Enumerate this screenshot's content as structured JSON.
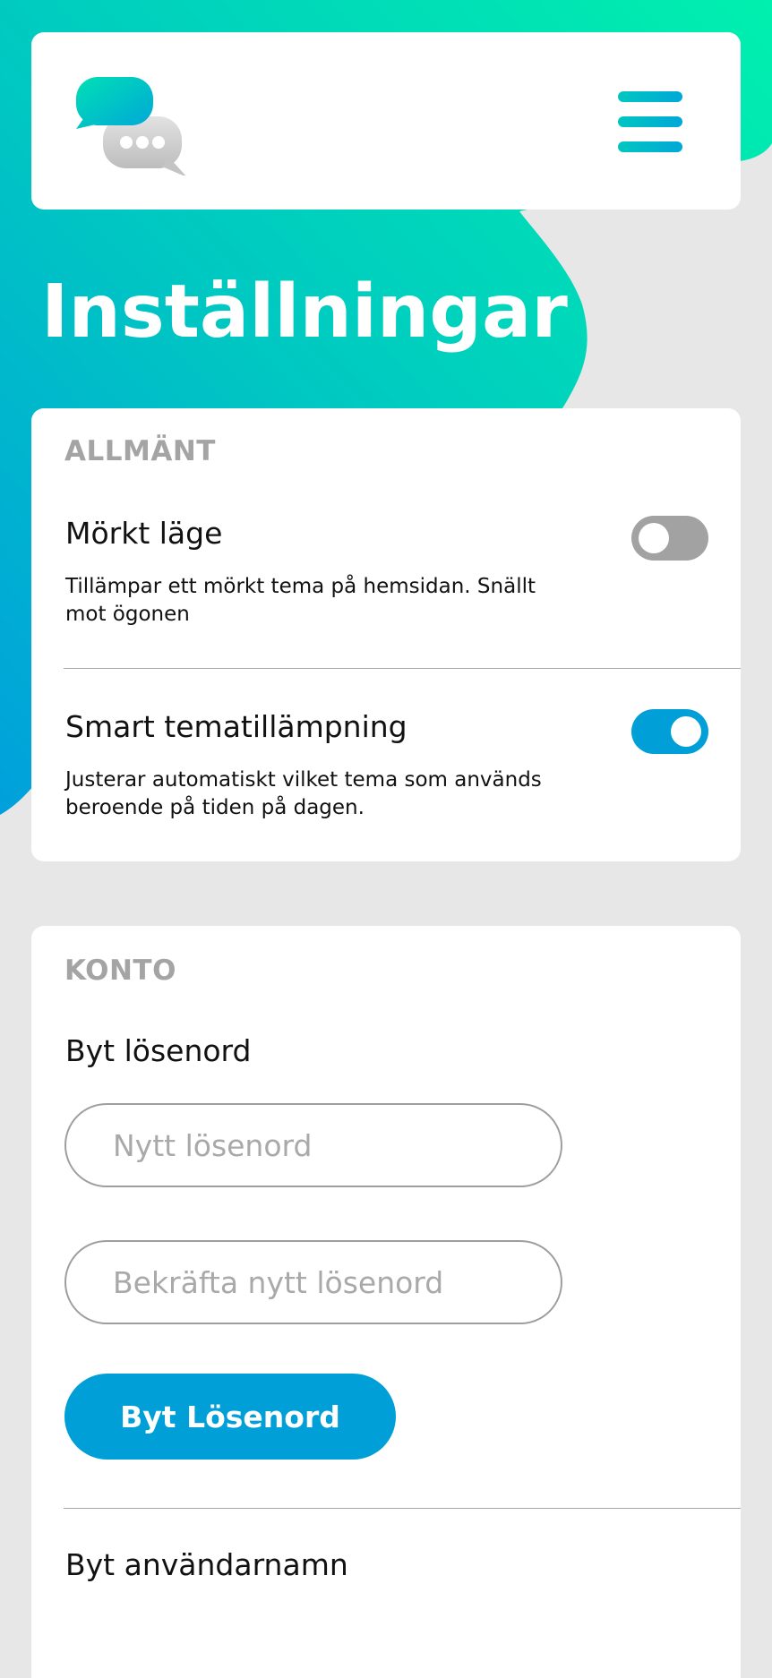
{
  "app": {
    "page_title": "Inställningar"
  },
  "header": {
    "logo_icon": "chat-bubbles-logo-icon",
    "menu_icon": "hamburger-menu-icon"
  },
  "colors": {
    "accent_gradient_start": "#00e6b0",
    "accent_gradient_end": "#00a3dc",
    "primary": "#009fd8",
    "toggle_off": "#a2a2a2",
    "background": "#e7e7e7",
    "section_label": "#a4a4a4"
  },
  "general": {
    "section_label": "ALLMÄNT",
    "dark_mode": {
      "title": "Mörkt läge",
      "description": "Tillämpar ett mörkt tema på hemsidan. Snällt mot ögonen",
      "enabled": false
    },
    "smart_theme": {
      "title": "Smart tematillämpning",
      "description": "Justerar automatiskt vilket tema som används beroende på tiden på dagen.",
      "enabled": true
    }
  },
  "account": {
    "section_label": "KONTO",
    "change_password": {
      "title": "Byt lösenord",
      "new_password_placeholder": "Nytt lösenord",
      "confirm_password_placeholder": "Bekräfta nytt lösenord",
      "button_label": "Byt Lösenord"
    },
    "change_username": {
      "title": "Byt användarnamn"
    }
  }
}
